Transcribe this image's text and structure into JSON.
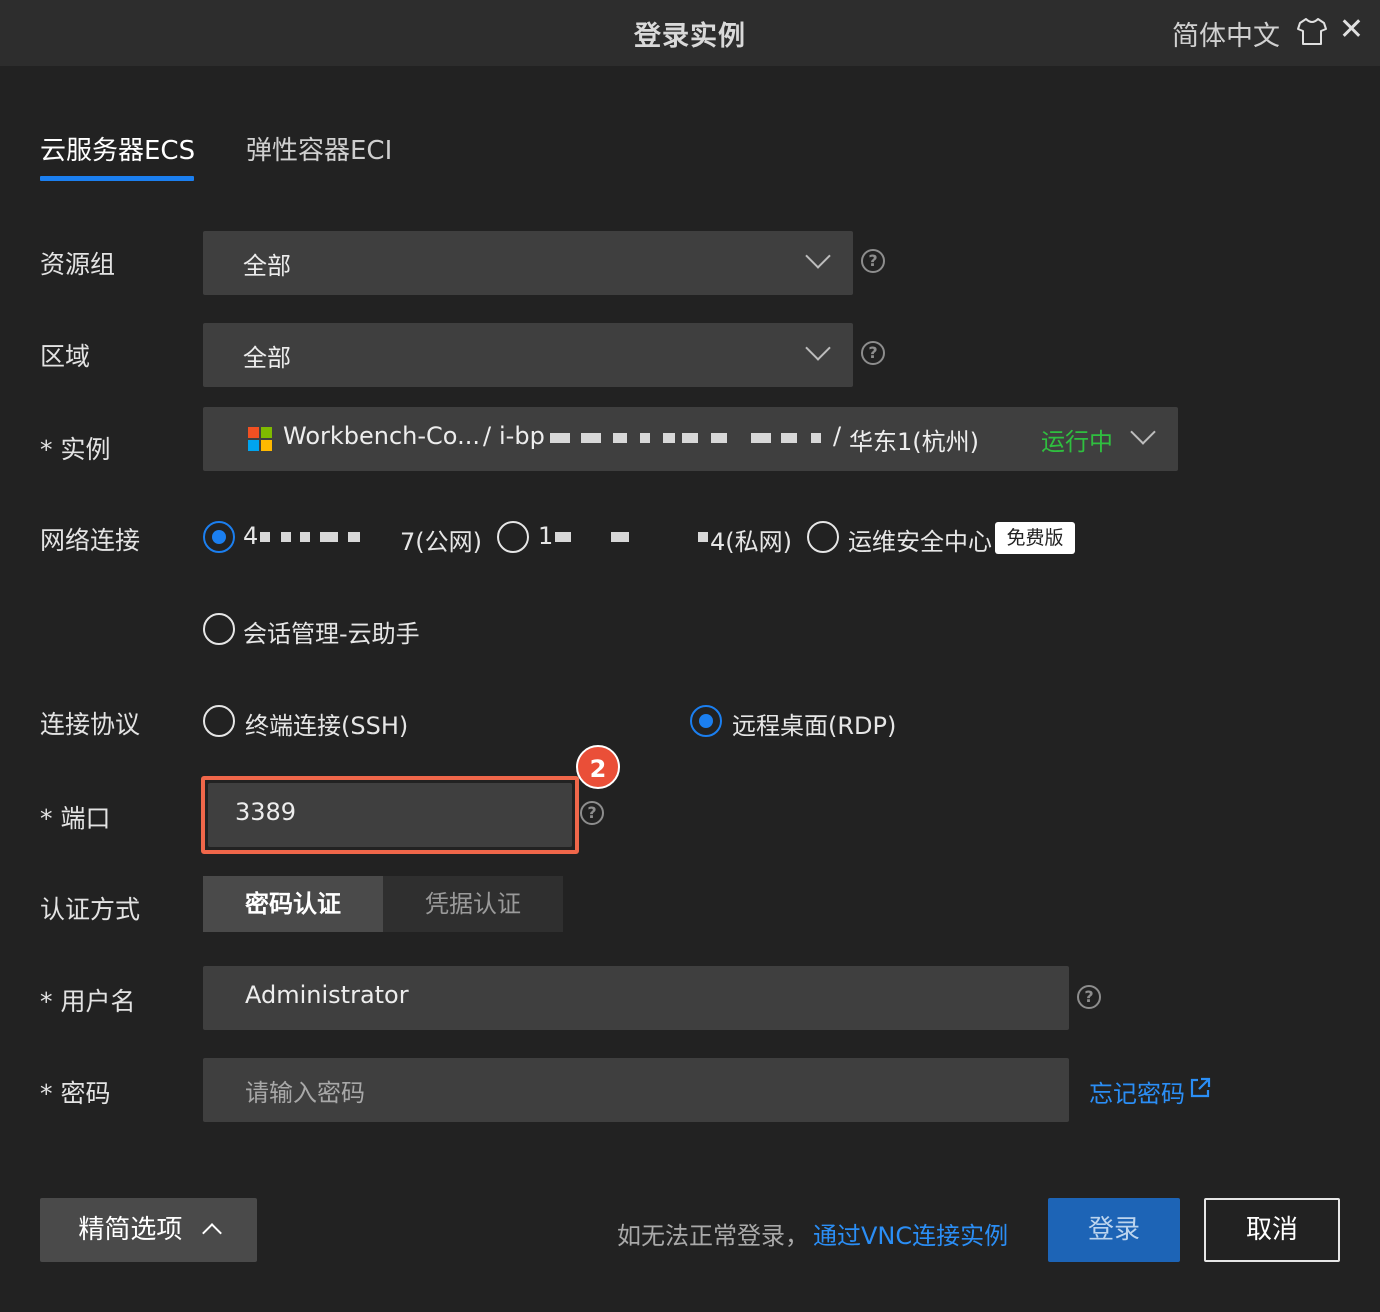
{
  "window": {
    "title": "登录实例",
    "language": "简体中文",
    "close_symbol": "✕"
  },
  "tabs": [
    {
      "label": "云服务器ECS",
      "active": true
    },
    {
      "label": "弹性容器ECI",
      "active": false
    }
  ],
  "form": {
    "resource_group": {
      "label": "资源组",
      "value": "全部"
    },
    "region": {
      "label": "区域",
      "value": "全部"
    },
    "instance": {
      "label": "* 实例",
      "name": "Workbench-Co...",
      "sep1": "/",
      "id_prefix": "i-bp",
      "sep2": "/",
      "zone": "华东1(杭州)",
      "status": "运行中",
      "status_color": "#2fbf3f"
    },
    "network": {
      "label": "网络连接",
      "options": [
        {
          "prefix": "4",
          "suffix": "7(公网)",
          "selected": true
        },
        {
          "prefix": "1",
          "suffix": "4(私网)",
          "selected": false
        },
        {
          "label": "运维安全中心",
          "badge": "免费版",
          "selected": false
        },
        {
          "label": "会话管理-云助手",
          "selected": false
        }
      ]
    },
    "protocol": {
      "label": "连接协议",
      "options": [
        {
          "label": "终端连接(SSH)",
          "selected": false
        },
        {
          "label": "远程桌面(RDP)",
          "selected": true
        }
      ]
    },
    "port": {
      "label": "* 端口",
      "value": "3389",
      "step_badge": "2"
    },
    "auth": {
      "label": "认证方式",
      "options": [
        {
          "label": "密码认证",
          "selected": true
        },
        {
          "label": "凭据认证",
          "selected": false
        }
      ]
    },
    "username": {
      "label": "* 用户名",
      "value": "Administrator"
    },
    "password": {
      "label": "* 密码",
      "placeholder": "请输入密码",
      "forgot_link": "忘记密码"
    }
  },
  "footer": {
    "advanced_label": "精简选项",
    "hint": "如无法正常登录，",
    "vnc_link": "通过VNC连接实例",
    "login_label": "登录",
    "cancel_label": "取消"
  },
  "colors": {
    "accent": "#1b7ff0",
    "highlight": "#f0674a",
    "link": "#2b8ef5",
    "primary_button": "#1d64b6"
  }
}
